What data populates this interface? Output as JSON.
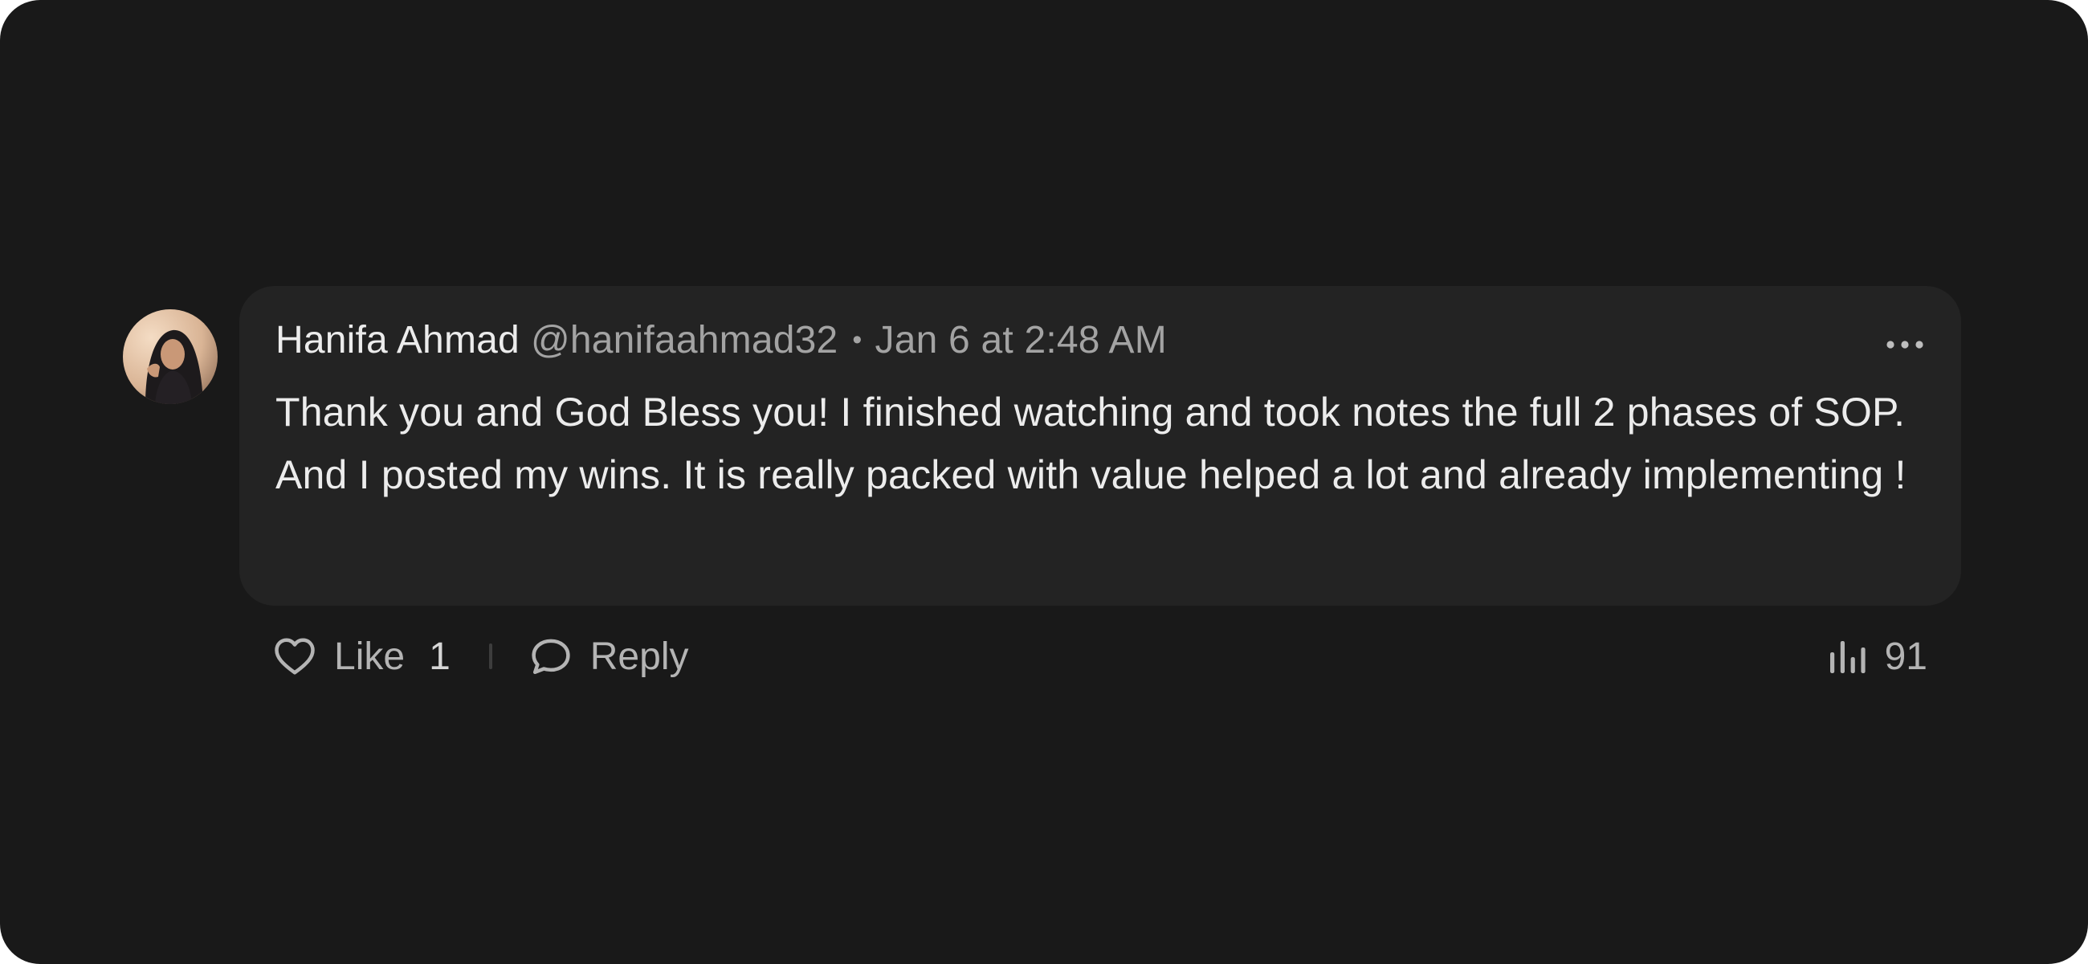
{
  "comment": {
    "author_name": "Hanifa Ahmad",
    "author_handle": "@hanifaahmad32",
    "separator": "•",
    "timestamp": "Jan 6 at 2:48 AM",
    "body": "Thank you and God Bless you! I finished watching and took notes the full 2 phases of SOP. And I posted my wins. It is really packed with value helped a lot and already implementing !"
  },
  "actions": {
    "like_label": "Like",
    "like_count": "1",
    "reply_label": "Reply",
    "views_count": "91"
  },
  "icons": {
    "more": "more-horizontal-icon",
    "like": "heart-icon",
    "reply": "chat-bubble-icon",
    "views": "bar-chart-icon"
  },
  "colors": {
    "background": "#191919",
    "bubble": "#232323",
    "primary_text": "#ececec",
    "secondary_text": "#a3a3a3"
  }
}
